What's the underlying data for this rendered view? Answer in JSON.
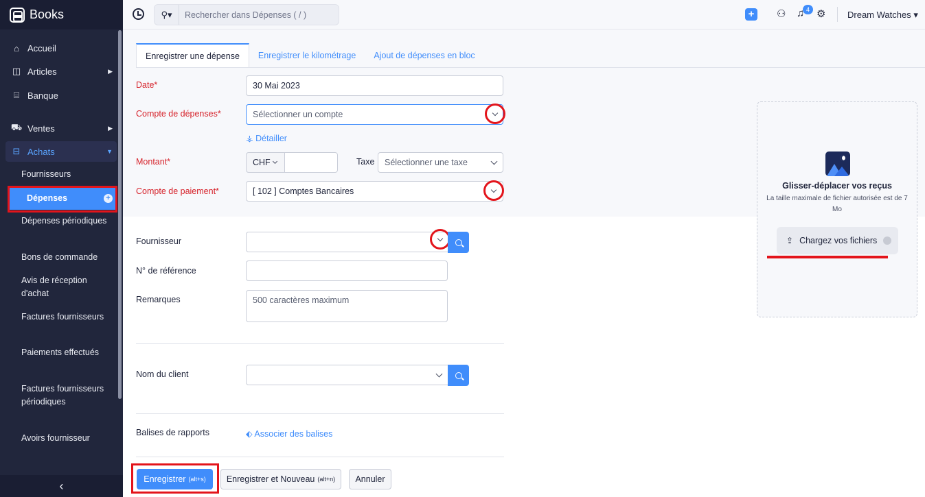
{
  "app": {
    "name": "Books"
  },
  "sidebar": {
    "items": [
      {
        "label": "Accueil",
        "icon": "home-icon"
      },
      {
        "label": "Articles",
        "icon": "box-icon"
      },
      {
        "label": "Banque",
        "icon": "bank-icon"
      },
      {
        "label": "Ventes",
        "icon": "cart-icon"
      },
      {
        "label": "Achats",
        "icon": "bag-icon"
      }
    ],
    "achats_sub": [
      "Fournisseurs",
      "Dépenses",
      "Dépenses périodiques",
      "Bons de commande",
      "Avis de réception d'achat",
      "Factures fournisseurs",
      "Paiements effectués",
      "Factures fournisseurs périodiques",
      "Avoirs fournisseur"
    ],
    "accent_color": "#408dfb"
  },
  "topbar": {
    "search_placeholder": "Rechercher dans Dépenses ( / )",
    "notification_count": "4",
    "org_name": "Dream Watches"
  },
  "tabs": [
    "Enregistrer une dépense",
    "Enregistrer le kilométrage",
    "Ajout de dépenses en bloc"
  ],
  "form": {
    "date_label": "Date*",
    "date_value": "30 Mai 2023",
    "expense_account_label": "Compte de dépenses*",
    "expense_account_placeholder": "Sélectionner un compte",
    "itemize_link": "Détailler",
    "amount_label": "Montant*",
    "currency": "CHF",
    "tax_label": "Taxe",
    "tax_placeholder": "Sélectionner une taxe",
    "paid_through_label": "Compte de paiement*",
    "paid_through_value": "[ 102 ] Comptes Bancaires",
    "vendor_label": "Fournisseur",
    "reference_label": "N° de référence",
    "notes_label": "Remarques",
    "notes_placeholder": "500 caractères maximum",
    "customer_label": "Nom du client",
    "reporting_tags_label": "Balises de rapports",
    "associate_tags_link": "Associer des balises"
  },
  "upload": {
    "title": "Glisser-déplacer vos reçus",
    "subtitle": "La taille maximale de fichier autorisée est de 7 Mo",
    "button": "Chargez vos fichiers"
  },
  "actions": {
    "save": "Enregistrer",
    "save_shortcut": "(alt+s)",
    "save_new": "Enregistrer et Nouveau",
    "save_new_shortcut": "(alt+n)",
    "cancel": "Annuler"
  }
}
